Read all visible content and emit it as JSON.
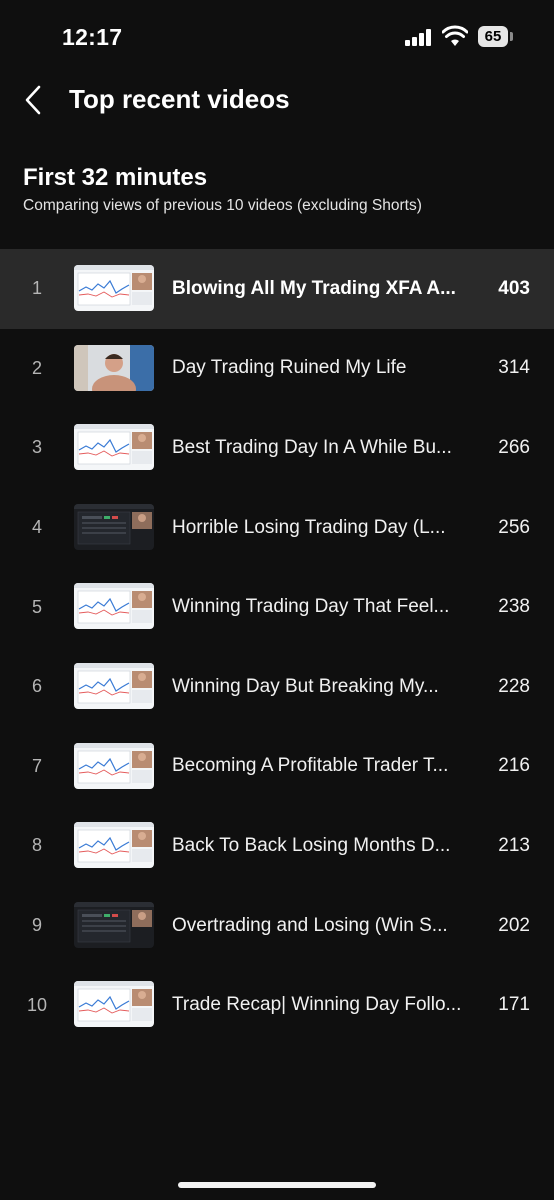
{
  "status_bar": {
    "time": "12:17",
    "battery": "65"
  },
  "header": {
    "title": "Top recent videos",
    "back_icon": "chevron-left-icon"
  },
  "section": {
    "title": "First 32 minutes",
    "subtitle": "Comparing views of previous 10 videos (excluding Shorts)"
  },
  "videos": [
    {
      "rank": "1",
      "title": "Blowing All My Trading XFA A...",
      "views": "403",
      "thumb": "light",
      "highlight": true
    },
    {
      "rank": "2",
      "title": "Day Trading Ruined My Life",
      "views": "314",
      "thumb": "person"
    },
    {
      "rank": "3",
      "title": "Best Trading Day In A While Bu...",
      "views": "266",
      "thumb": "light"
    },
    {
      "rank": "4",
      "title": "Horrible Losing Trading Day (L...",
      "views": "256",
      "thumb": "dark"
    },
    {
      "rank": "5",
      "title": "Winning Trading Day That Feel...",
      "views": "238",
      "thumb": "light"
    },
    {
      "rank": "6",
      "title": "Winning Day But Breaking My...",
      "views": "228",
      "thumb": "light"
    },
    {
      "rank": "7",
      "title": "Becoming A Profitable Trader T...",
      "views": "216",
      "thumb": "light"
    },
    {
      "rank": "8",
      "title": "Back To Back Losing Months D...",
      "views": "213",
      "thumb": "light"
    },
    {
      "rank": "9",
      "title": "Overtrading and Losing (Win S...",
      "views": "202",
      "thumb": "dark"
    },
    {
      "rank": "10",
      "title": "Trade Recap| Winning Day Follo...",
      "views": "171",
      "thumb": "light"
    }
  ],
  "colors": {
    "background": "#0f0f0f",
    "highlight_row": "#2a2a2a",
    "text": "#ffffff",
    "muted": "#b5b5b5"
  }
}
